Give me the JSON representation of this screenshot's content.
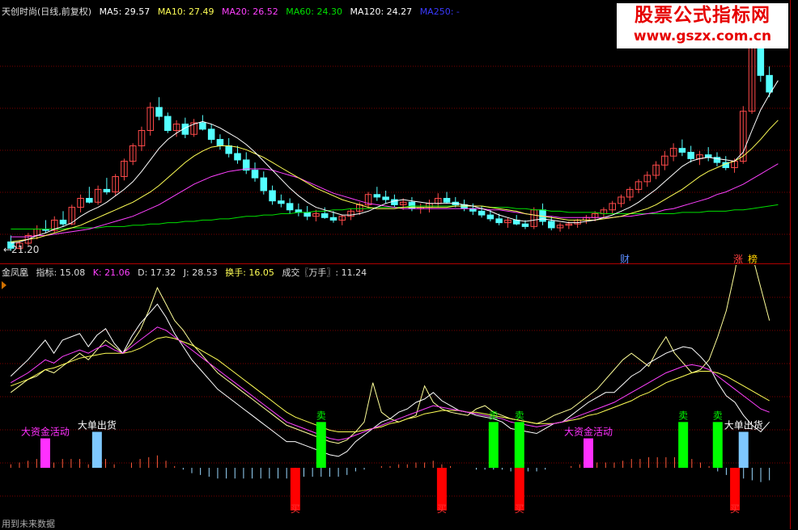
{
  "upper_legend": {
    "title": "天创时尚(日线,前复权)",
    "ma5": "MA5: 29.57",
    "ma10": "MA10: 27.49",
    "ma20": "MA20: 26.52",
    "ma60": "MA60: 24.30",
    "ma120": "MA120: 24.27",
    "ma250": "MA250: -"
  },
  "lower_legend": {
    "title": "金凤凰",
    "indicator": "指标: 15.08",
    "k": "K: 21.06",
    "d": "D: 17.32",
    "j": "J: 28.53",
    "turnover": "换手: 16.05",
    "volume": "成交〖万手〗: 11.24"
  },
  "watermark": {
    "title": "股票公式指标网",
    "url": "www.gszx.com.cn"
  },
  "markers": {
    "low_price": "←21.20",
    "cai": "财",
    "zhang": "涨",
    "bang": "榜"
  },
  "footer": "用到未来数据",
  "colors": {
    "up": "#ff4a4a",
    "down": "#54ffff",
    "ma5": "#ffffff",
    "ma10": "#ffff55",
    "ma20": "#ff40ff",
    "ma60": "#00e000",
    "ma120": "#ffffff",
    "ma250": "#3030ff",
    "grid": "#7a0000"
  },
  "chart_data": [
    {
      "type": "candlestick",
      "title": "天创时尚(日线,前复权)",
      "low_label": 21.2,
      "ohlc": [
        [
          21.9,
          22.4,
          21.2,
          21.4
        ],
        [
          21.4,
          22.0,
          21.3,
          21.8
        ],
        [
          21.8,
          22.6,
          21.6,
          22.4
        ],
        [
          22.4,
          23.2,
          22.1,
          22.9
        ],
        [
          22.9,
          23.6,
          22.6,
          22.8
        ],
        [
          22.8,
          23.9,
          22.6,
          23.6
        ],
        [
          23.6,
          24.3,
          23.1,
          23.3
        ],
        [
          23.3,
          24.8,
          23.2,
          24.6
        ],
        [
          24.6,
          25.6,
          24.2,
          25.3
        ],
        [
          25.3,
          26.2,
          24.9,
          25.0
        ],
        [
          25.0,
          26.3,
          24.8,
          26.0
        ],
        [
          26.0,
          26.9,
          25.6,
          25.8
        ],
        [
          25.8,
          27.2,
          25.5,
          27.0
        ],
        [
          27.0,
          28.4,
          26.7,
          28.2
        ],
        [
          28.2,
          29.6,
          27.9,
          29.4
        ],
        [
          29.4,
          30.9,
          29.0,
          30.6
        ],
        [
          30.6,
          32.8,
          30.2,
          32.4
        ],
        [
          32.4,
          33.2,
          31.4,
          31.7
        ],
        [
          31.7,
          32.0,
          30.4,
          30.6
        ],
        [
          30.6,
          31.4,
          30.1,
          31.1
        ],
        [
          31.1,
          31.6,
          30.0,
          30.3
        ],
        [
          30.3,
          31.5,
          30.1,
          31.2
        ],
        [
          31.2,
          31.8,
          30.6,
          30.7
        ],
        [
          30.7,
          31.1,
          29.6,
          29.9
        ],
        [
          29.9,
          30.3,
          29.1,
          29.4
        ],
        [
          29.4,
          30.0,
          28.5,
          28.8
        ],
        [
          28.8,
          29.4,
          28.0,
          28.3
        ],
        [
          28.3,
          28.9,
          27.2,
          27.5
        ],
        [
          27.5,
          28.1,
          26.6,
          26.9
        ],
        [
          26.9,
          27.4,
          25.6,
          25.9
        ],
        [
          25.9,
          26.3,
          24.8,
          25.1
        ],
        [
          25.1,
          25.6,
          24.6,
          24.9
        ],
        [
          24.9,
          25.3,
          24.1,
          24.4
        ],
        [
          24.4,
          24.9,
          23.9,
          24.2
        ],
        [
          24.2,
          24.7,
          23.6,
          23.9
        ],
        [
          23.9,
          24.4,
          23.5,
          24.1
        ],
        [
          24.1,
          24.6,
          23.7,
          23.8
        ],
        [
          23.8,
          24.3,
          23.4,
          23.6
        ],
        [
          23.6,
          24.0,
          23.2,
          23.9
        ],
        [
          23.9,
          24.5,
          23.6,
          24.3
        ],
        [
          24.3,
          25.0,
          24.0,
          24.8
        ],
        [
          24.8,
          25.8,
          24.5,
          25.6
        ],
        [
          25.6,
          26.2,
          25.1,
          25.4
        ],
        [
          25.4,
          25.9,
          24.9,
          25.2
        ],
        [
          25.2,
          25.6,
          24.6,
          24.8
        ],
        [
          24.8,
          25.3,
          24.4,
          25.0
        ],
        [
          25.0,
          25.4,
          24.3,
          24.5
        ],
        [
          24.5,
          24.9,
          24.1,
          24.6
        ],
        [
          24.6,
          25.2,
          24.2,
          24.9
        ],
        [
          24.9,
          25.7,
          24.6,
          25.3
        ],
        [
          25.3,
          25.8,
          24.9,
          25.0
        ],
        [
          25.0,
          25.4,
          24.6,
          24.8
        ],
        [
          24.8,
          25.2,
          24.3,
          24.5
        ],
        [
          24.5,
          24.9,
          24.0,
          24.3
        ],
        [
          24.3,
          24.7,
          23.8,
          24.0
        ],
        [
          24.0,
          24.4,
          23.5,
          23.7
        ],
        [
          23.7,
          24.1,
          23.2,
          23.4
        ],
        [
          23.4,
          23.8,
          23.0,
          23.6
        ],
        [
          23.6,
          24.0,
          23.2,
          23.3
        ],
        [
          23.3,
          23.6,
          22.9,
          23.1
        ],
        [
          23.1,
          24.6,
          22.9,
          24.4
        ],
        [
          24.4,
          24.9,
          23.2,
          23.5
        ],
        [
          23.5,
          23.9,
          22.8,
          23.0
        ],
        [
          23.0,
          23.4,
          22.7,
          23.2
        ],
        [
          23.2,
          23.5,
          22.9,
          23.3
        ],
        [
          23.3,
          23.7,
          23.0,
          23.6
        ],
        [
          23.6,
          24.0,
          23.3,
          23.8
        ],
        [
          23.8,
          24.3,
          23.5,
          24.1
        ],
        [
          24.1,
          24.6,
          23.8,
          24.4
        ],
        [
          24.4,
          25.1,
          24.1,
          24.9
        ],
        [
          24.9,
          25.6,
          24.6,
          25.4
        ],
        [
          25.4,
          26.2,
          25.1,
          26.0
        ],
        [
          26.0,
          26.8,
          25.7,
          26.6
        ],
        [
          26.6,
          27.4,
          26.2,
          27.1
        ],
        [
          27.1,
          28.2,
          26.8,
          27.9
        ],
        [
          27.9,
          29.0,
          27.5,
          28.6
        ],
        [
          28.6,
          29.6,
          28.2,
          29.2
        ],
        [
          29.2,
          29.9,
          28.6,
          28.9
        ],
        [
          28.9,
          29.4,
          28.1,
          28.4
        ],
        [
          28.4,
          29.0,
          27.9,
          28.7
        ],
        [
          28.7,
          29.3,
          28.2,
          28.5
        ],
        [
          28.5,
          28.9,
          27.8,
          28.1
        ],
        [
          28.1,
          28.6,
          27.5,
          27.7
        ],
        [
          27.7,
          28.4,
          27.3,
          28.2
        ],
        [
          28.2,
          32.5,
          28.0,
          32.1
        ],
        [
          32.1,
          37.8,
          31.9,
          37.5
        ],
        [
          37.5,
          38.2,
          34.4,
          34.9
        ],
        [
          34.9,
          35.6,
          33.2,
          33.6
        ]
      ],
      "ma5": [
        21.8,
        21.9,
        22.1,
        22.4,
        22.6,
        22.9,
        23.1,
        23.4,
        23.9,
        24.3,
        24.6,
        25.0,
        25.5,
        26.0,
        26.6,
        27.4,
        28.3,
        29.2,
        29.9,
        30.4,
        30.8,
        31.1,
        31.3,
        31.1,
        30.8,
        30.4,
        30.0,
        29.5,
        28.9,
        28.2,
        27.5,
        26.8,
        26.1,
        25.5,
        25.0,
        24.6,
        24.4,
        24.2,
        24.0,
        24.0,
        24.1,
        24.3,
        24.6,
        24.9,
        25.1,
        25.2,
        25.1,
        25.0,
        24.9,
        24.9,
        24.9,
        24.9,
        24.8,
        24.7,
        24.5,
        24.3,
        24.0,
        23.8,
        23.6,
        23.5,
        23.6,
        23.7,
        23.6,
        23.5,
        23.4,
        23.4,
        23.5,
        23.6,
        23.8,
        24.0,
        24.3,
        24.6,
        25.0,
        25.5,
        26.0,
        26.6,
        27.2,
        27.8,
        28.2,
        28.4,
        28.5,
        28.4,
        28.3,
        28.2,
        28.9,
        30.6,
        32.2,
        33.4,
        34.5
      ],
      "ma10": [
        21.9,
        22.0,
        22.1,
        22.2,
        22.4,
        22.6,
        22.8,
        23.0,
        23.2,
        23.5,
        23.8,
        24.1,
        24.4,
        24.7,
        25.0,
        25.4,
        25.8,
        26.3,
        26.9,
        27.5,
        28.1,
        28.6,
        29.0,
        29.3,
        29.4,
        29.4,
        29.3,
        29.1,
        28.8,
        28.5,
        28.1,
        27.7,
        27.3,
        26.9,
        26.5,
        26.1,
        25.8,
        25.5,
        25.2,
        25.0,
        24.8,
        24.6,
        24.5,
        24.5,
        24.5,
        24.6,
        24.6,
        24.6,
        24.6,
        24.6,
        24.6,
        24.7,
        24.7,
        24.7,
        24.7,
        24.6,
        24.5,
        24.4,
        24.3,
        24.1,
        24.0,
        23.9,
        23.8,
        23.7,
        23.6,
        23.6,
        23.6,
        23.6,
        23.7,
        23.8,
        23.9,
        24.1,
        24.3,
        24.5,
        24.8,
        25.2,
        25.6,
        26.0,
        26.5,
        27.0,
        27.4,
        27.7,
        28.0,
        28.2,
        28.6,
        29.2,
        29.9,
        30.7,
        31.4
      ],
      "ma20": [
        22.3,
        22.3,
        22.3,
        22.4,
        22.4,
        22.5,
        22.6,
        22.7,
        22.8,
        22.9,
        23.1,
        23.3,
        23.5,
        23.7,
        23.9,
        24.2,
        24.5,
        24.8,
        25.2,
        25.6,
        26.0,
        26.4,
        26.7,
        27.0,
        27.2,
        27.4,
        27.5,
        27.6,
        27.6,
        27.6,
        27.5,
        27.3,
        27.1,
        26.9,
        26.6,
        26.3,
        26.0,
        25.7,
        25.5,
        25.3,
        25.1,
        24.9,
        24.8,
        24.7,
        24.6,
        24.5,
        24.5,
        24.5,
        24.5,
        24.5,
        24.5,
        24.5,
        24.5,
        24.5,
        24.5,
        24.4,
        24.4,
        24.3,
        24.2,
        24.1,
        24.0,
        23.9,
        23.9,
        23.8,
        23.8,
        23.8,
        23.8,
        23.8,
        23.8,
        23.8,
        23.9,
        23.9,
        24.0,
        24.1,
        24.2,
        24.4,
        24.5,
        24.7,
        24.9,
        25.1,
        25.3,
        25.6,
        25.8,
        26.1,
        26.4,
        26.8,
        27.2,
        27.6,
        28.0
      ],
      "ma60": [
        22.9,
        22.9,
        22.9,
        22.9,
        22.9,
        22.9,
        22.9,
        23.0,
        23.0,
        23.0,
        23.0,
        23.1,
        23.1,
        23.1,
        23.2,
        23.2,
        23.3,
        23.3,
        23.4,
        23.4,
        23.5,
        23.5,
        23.6,
        23.6,
        23.7,
        23.7,
        23.8,
        23.9,
        23.9,
        24.0,
        24.0,
        24.1,
        24.1,
        24.2,
        24.2,
        24.3,
        24.3,
        24.4,
        24.4,
        24.5,
        24.5,
        24.5,
        24.6,
        24.6,
        24.6,
        24.6,
        24.7,
        24.7,
        24.7,
        24.7,
        24.7,
        24.7,
        24.7,
        24.7,
        24.7,
        24.6,
        24.6,
        24.6,
        24.5,
        24.5,
        24.4,
        24.4,
        24.3,
        24.3,
        24.2,
        24.2,
        24.2,
        24.2,
        24.1,
        24.1,
        24.1,
        24.1,
        24.1,
        24.1,
        24.1,
        24.1,
        24.1,
        24.2,
        24.2,
        24.2,
        24.3,
        24.3,
        24.3,
        24.4,
        24.4,
        24.5,
        24.6,
        24.7,
        24.8
      ],
      "y_range": [
        20.6,
        39.4
      ],
      "grid": true
    },
    {
      "type": "mixed-indicator",
      "title": "金凤凰",
      "values": {
        "indicator": 15.08,
        "K": 21.06,
        "D": 17.32,
        "J": 28.53,
        "turnover": 16.05,
        "volume_wan": 11.24
      },
      "k": [
        52,
        55,
        58,
        62,
        66,
        64,
        68,
        70,
        72,
        70,
        73,
        75,
        72,
        70,
        74,
        78,
        82,
        86,
        84,
        80,
        76,
        72,
        68,
        64,
        60,
        56,
        52,
        48,
        44,
        40,
        36,
        32,
        28,
        26,
        24,
        22,
        20,
        18,
        17,
        18,
        20,
        22,
        24,
        26,
        28,
        30,
        32,
        34,
        36,
        38,
        37,
        36,
        35,
        34,
        33,
        32,
        31,
        30,
        28,
        27,
        26,
        25,
        26,
        27,
        28,
        30,
        32,
        34,
        36,
        38,
        40,
        43,
        46,
        49,
        52,
        55,
        58,
        60,
        62,
        63,
        62,
        60,
        56,
        52,
        48,
        44,
        40,
        36,
        34
      ],
      "d": [
        50,
        52,
        54,
        57,
        60,
        61,
        63,
        65,
        67,
        68,
        69,
        70,
        70,
        70,
        71,
        73,
        76,
        79,
        80,
        79,
        77,
        75,
        72,
        69,
        66,
        62,
        58,
        54,
        50,
        46,
        42,
        38,
        34,
        31,
        29,
        27,
        25,
        23,
        22,
        22,
        22,
        23,
        24,
        25,
        27,
        28,
        30,
        31,
        33,
        34,
        35,
        35,
        35,
        34,
        34,
        33,
        32,
        31,
        30,
        29,
        28,
        27,
        27,
        27,
        28,
        29,
        30,
        32,
        33,
        35,
        37,
        39,
        41,
        44,
        46,
        49,
        52,
        54,
        56,
        58,
        59,
        59,
        58,
        56,
        53,
        50,
        47,
        44,
        41
      ],
      "j": [
        56,
        61,
        66,
        72,
        78,
        70,
        78,
        80,
        82,
        74,
        81,
        85,
        76,
        70,
        80,
        88,
        94,
        100,
        92,
        82,
        74,
        66,
        60,
        54,
        48,
        44,
        40,
        36,
        32,
        28,
        24,
        20,
        16,
        16,
        14,
        12,
        10,
        8,
        7,
        10,
        16,
        20,
        24,
        28,
        30,
        34,
        36,
        40,
        42,
        46,
        41,
        38,
        35,
        34,
        32,
        31,
        30,
        28,
        24,
        23,
        22,
        21,
        24,
        27,
        28,
        32,
        36,
        40,
        43,
        46,
        46,
        51,
        56,
        59,
        64,
        67,
        70,
        72,
        74,
        73,
        68,
        62,
        52,
        44,
        40,
        32,
        26,
        22,
        28
      ],
      "indicator": [
        46,
        50,
        54,
        56,
        60,
        58,
        62,
        66,
        70,
        66,
        72,
        78,
        74,
        70,
        76,
        84,
        96,
        110,
        100,
        90,
        84,
        76,
        70,
        64,
        58,
        54,
        50,
        46,
        42,
        38,
        34,
        30,
        26,
        24,
        22,
        20,
        18,
        16,
        15,
        17,
        22,
        28,
        52,
        34,
        30,
        28,
        30,
        32,
        50,
        40,
        36,
        34,
        33,
        32,
        36,
        38,
        34,
        32,
        30,
        29,
        28,
        27,
        29,
        32,
        34,
        36,
        40,
        44,
        48,
        54,
        60,
        66,
        70,
        66,
        62,
        72,
        80,
        70,
        64,
        58,
        60,
        66,
        80,
        96,
        120,
        150,
        130,
        110,
        90
      ],
      "bar_signals": [
        {
          "label": "大资金活动",
          "value": 18,
          "color": "#ff30ff"
        },
        {
          "label": "大单出货",
          "value": 22,
          "color": "#7ec8ff"
        },
        {
          "label": "卖",
          "value": 28,
          "color": "#00ff00"
        },
        {
          "label": "卖",
          "value": 28,
          "color": "#00ff00"
        },
        {
          "label": "卖",
          "value": 28,
          "color": "#00ff00"
        },
        {
          "label": "大资金活动",
          "value": 18,
          "color": "#ff30ff"
        },
        {
          "label": "卖",
          "value": 28,
          "color": "#00ff00"
        },
        {
          "label": "卖",
          "value": 28,
          "color": "#00ff00"
        },
        {
          "label": "大单出货",
          "value": 22,
          "color": "#7ec8ff"
        }
      ],
      "buy_signals": [
        {
          "label": "买",
          "value": -26,
          "color": "#ff0000"
        },
        {
          "label": "买",
          "value": -26,
          "color": "#ff0000"
        },
        {
          "label": "买",
          "value": -26,
          "color": "#ff0000"
        },
        {
          "label": "买",
          "value": -26,
          "color": "#ff0000"
        }
      ],
      "y_range": [
        -35,
        115
      ],
      "grid": true
    }
  ]
}
